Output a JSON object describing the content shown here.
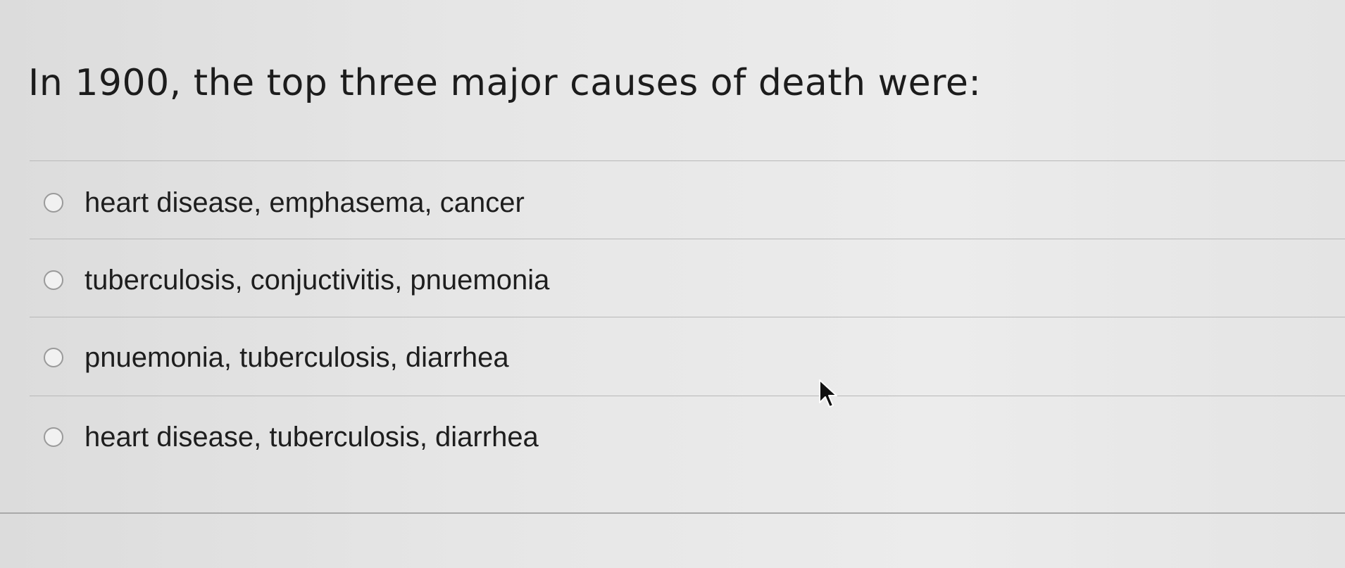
{
  "question": {
    "text": "In 1900, the top three major causes of death were:"
  },
  "options": [
    {
      "label": "heart disease, emphasema, cancer"
    },
    {
      "label": "tuberculosis, conjuctivitis, pnuemonia"
    },
    {
      "label": "pnuemonia, tuberculosis, diarrhea"
    },
    {
      "label": "heart disease, tuberculosis, diarrhea"
    }
  ],
  "icons": {
    "radio": "radio-unselected-icon",
    "cursor": "mouse-pointer-icon"
  }
}
